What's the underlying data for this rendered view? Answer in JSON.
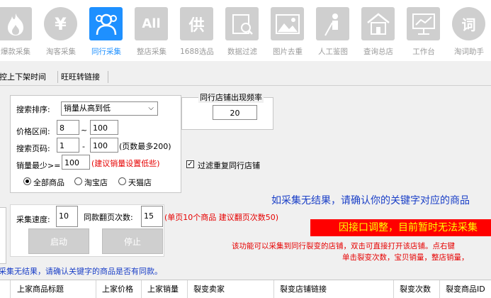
{
  "toolbar": {
    "items": [
      {
        "label": "爆款采集",
        "icon": "flame-icon"
      },
      {
        "label": "淘客采集",
        "icon": "yen-icon",
        "glyph": "¥"
      },
      {
        "label": "同行采集",
        "icon": "people-icon",
        "active": true
      },
      {
        "label": "整店采集",
        "icon": "all-icon",
        "glyph": "All"
      },
      {
        "label": "1688选品",
        "icon": "supply-icon",
        "glyph": "供"
      },
      {
        "label": "数据过滤",
        "icon": "filter-icon"
      },
      {
        "label": "图片去重",
        "icon": "image-icon"
      },
      {
        "label": "人工鉴图",
        "icon": "worker-icon"
      },
      {
        "label": "查询总店",
        "icon": "store-icon"
      },
      {
        "label": "工作台",
        "icon": "workbench-icon"
      },
      {
        "label": "淘词助手",
        "icon": "word-icon",
        "glyph": "词"
      }
    ]
  },
  "tabs": [
    {
      "label": "监控上下架时间"
    },
    {
      "label": "旺旺转链接"
    }
  ],
  "search": {
    "sort_label": "搜索排序:",
    "sort_value": "销量从高到低",
    "price_label": "价格区间:",
    "price_min": "8",
    "price_sep": "~",
    "price_max": "100",
    "page_label": "搜索页码:",
    "page_min": "1",
    "page_sep": "-",
    "page_max": "100",
    "page_hint": "(页数最多200)",
    "sales_label": "销量最少>=",
    "sales_value": "100",
    "sales_hint": "(建议销量设置低些)",
    "radio_all": "全部商品",
    "radio_taobao": "淘宝店",
    "radio_tmall": "天猫店"
  },
  "frequency": {
    "title": "同行店铺出现频率",
    "value": "20"
  },
  "filter_dup_label": "过滤重复同行店铺",
  "notice_blue": "如采集无结果，请确认你的关键字对应的商品",
  "controls": {
    "speed_label": "采集速度:",
    "speed_value": "10",
    "pages_label": "同款翻页次数:",
    "pages_value": "15",
    "pages_hint": "(单页10个商品 建议翻页次数50)",
    "start_label": "启动",
    "stop_label": "停止"
  },
  "banner_text": "因接口调整，目前暂时无法采集",
  "info_line1": "该功能可以采集到同行裂变的店铺，双击可直接打开该店铺。点右键",
  "info_line2": "单击裂变次数，宝贝销量，整店销量，",
  "status_text": "采集无结果，请确认关键字的商品是否有同款。",
  "table_headers": [
    "上家商品标题",
    "上家价格",
    "上家销量",
    "裂变卖家",
    "裂变店铺链接",
    "裂变次数",
    "裂变商品ID"
  ],
  "colors": {
    "accent": "#1e90ff",
    "banner_bg": "#ff0000",
    "banner_fg": "#ffff00",
    "hint_red": "#e60000",
    "notice_blue": "#1a3fc7"
  }
}
